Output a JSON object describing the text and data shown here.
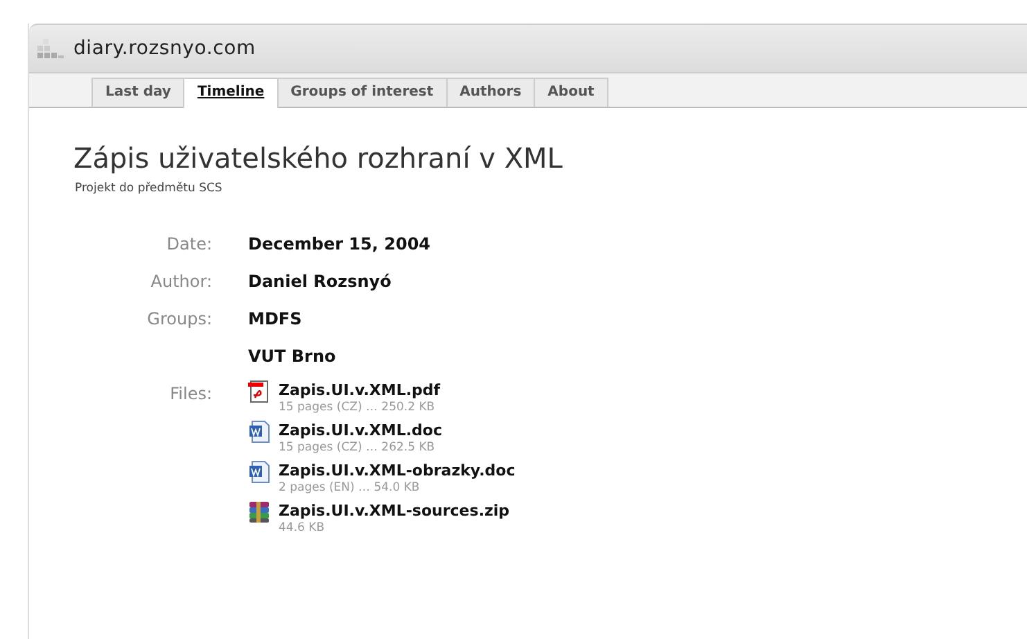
{
  "site": {
    "title": "diary.rozsnyo.com"
  },
  "tabs": [
    {
      "label": "Last day",
      "selected": false
    },
    {
      "label": "Timeline",
      "selected": true
    },
    {
      "label": "Groups of interest",
      "selected": false
    },
    {
      "label": "Authors",
      "selected": false
    },
    {
      "label": "About",
      "selected": false
    }
  ],
  "article": {
    "title": "Zápis uživatelského rozhraní v XML",
    "subtitle": "Projekt do předmětu SCS"
  },
  "fields": [
    {
      "label": "Date:",
      "values": [
        "December 15, 2004"
      ]
    },
    {
      "label": "Author:",
      "values": [
        "Daniel Rozsnyó"
      ]
    },
    {
      "label": "Groups:",
      "values": [
        "MDFS",
        "VUT Brno"
      ]
    }
  ],
  "files": {
    "label": "Files:",
    "items": [
      {
        "kind": "pdf",
        "name": "Zapis.UI.v.XML.pdf",
        "info": "15 pages (CZ) … 250.2 KB"
      },
      {
        "kind": "doc",
        "name": "Zapis.UI.v.XML.doc",
        "info": "15 pages (CZ) … 262.5 KB"
      },
      {
        "kind": "doc",
        "name": "Zapis.UI.v.XML-obrazky.doc",
        "info": "2 pages (EN) … 54.0 KB"
      },
      {
        "kind": "zip",
        "name": "Zapis.UI.v.XML-sources.zip",
        "info": "44.6 KB"
      }
    ]
  }
}
